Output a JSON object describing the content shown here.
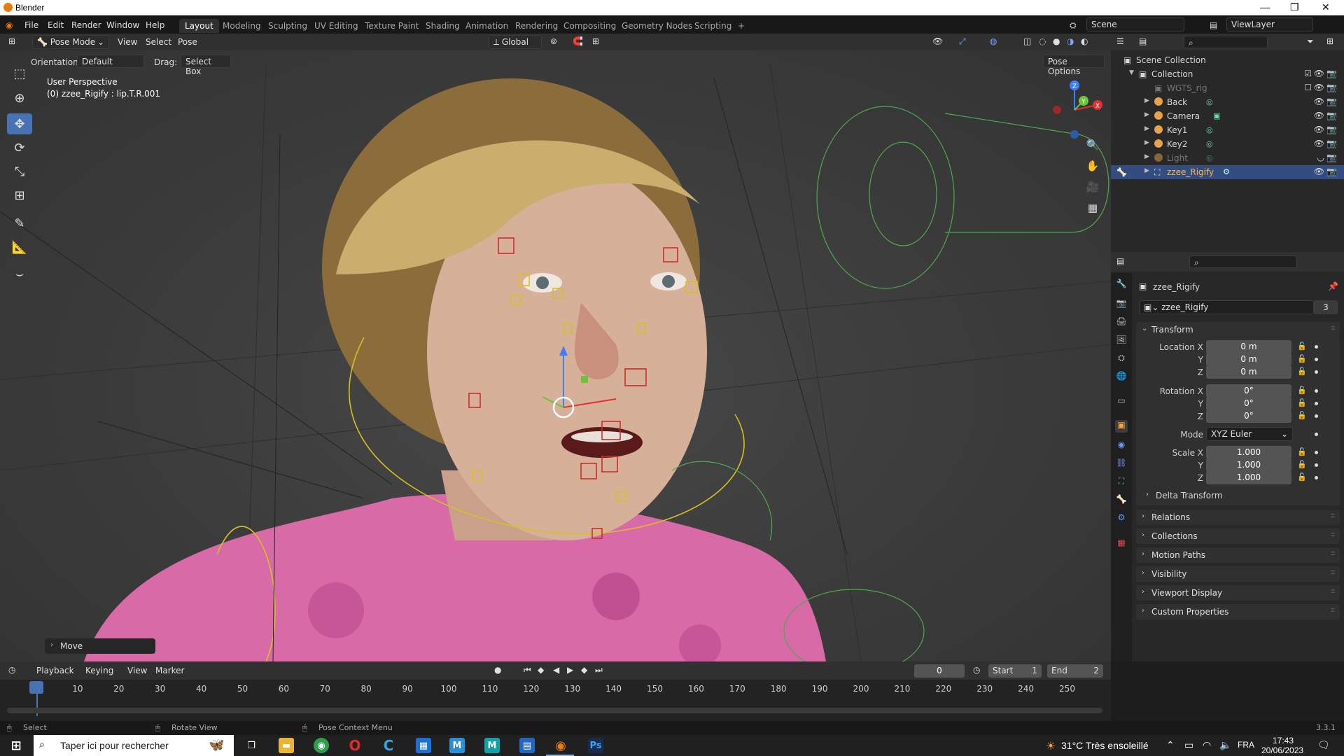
{
  "window": {
    "title": "Blender"
  },
  "menus": [
    "File",
    "Edit",
    "Render",
    "Window",
    "Help"
  ],
  "workspaces": [
    "Layout",
    "Modeling",
    "Sculpting",
    "UV Editing",
    "Texture Paint",
    "Shading",
    "Animation",
    "Rendering",
    "Compositing",
    "Geometry Nodes",
    "Scripting",
    "+"
  ],
  "active_workspace": "Layout",
  "scene": {
    "label": "Scene",
    "view_layer": "ViewLayer"
  },
  "viewport_header": {
    "mode": "Pose Mode",
    "menus": [
      "View",
      "Select",
      "Pose"
    ],
    "transform_orientation": "Global",
    "orientation_label": "Orientation:",
    "orientation_value": "Default",
    "drag_label": "Drag:",
    "drag_value": "Select Box",
    "pose_options": "Pose Options"
  },
  "viewport": {
    "perspective": "User Perspective",
    "active_info": "(0) zzee_Rigify : lip.T.R.001",
    "last_op": "Move",
    "gizmo_axes": [
      "Z",
      "Y",
      "X"
    ]
  },
  "outliner": {
    "root": "Scene Collection",
    "collection": "Collection",
    "items": [
      {
        "name": "WGTS_rig",
        "dim": true
      },
      {
        "name": "Back",
        "dim": false
      },
      {
        "name": "Camera",
        "dim": false
      },
      {
        "name": "Key1",
        "dim": false
      },
      {
        "name": "Key2",
        "dim": false
      },
      {
        "name": "Light",
        "dim": true
      },
      {
        "name": "zzee_Rigify",
        "dim": false,
        "selected": true
      }
    ]
  },
  "properties": {
    "object_name": "zzee_Rigify",
    "datablock_name": "zzee_Rigify",
    "users": "3",
    "transform_title": "Transform",
    "location_label": "Location X",
    "location": [
      "0 m",
      "0 m",
      "0 m"
    ],
    "rotation_label": "Rotation X",
    "rotation": [
      "0°",
      "0°",
      "0°"
    ],
    "mode_label": "Mode",
    "mode_value": "XYZ Euler",
    "scale_label": "Scale X",
    "scale": [
      "1.000",
      "1.000",
      "1.000"
    ],
    "axis_y": "Y",
    "axis_z": "Z",
    "delta_transform": "Delta Transform",
    "panels": [
      "Relations",
      "Collections",
      "Motion Paths",
      "Visibility",
      "Viewport Display",
      "Custom Properties"
    ]
  },
  "timeline": {
    "menus": [
      "Playback",
      "Keying",
      "View",
      "Marker"
    ],
    "current_frame": "0",
    "start_label": "Start",
    "start": "1",
    "end_label": "End",
    "end": "2",
    "ticks": [
      "0",
      "10",
      "20",
      "30",
      "40",
      "50",
      "60",
      "70",
      "80",
      "90",
      "100",
      "110",
      "120",
      "130",
      "140",
      "150",
      "160",
      "170",
      "180",
      "190",
      "200",
      "210",
      "220",
      "230",
      "240",
      "250"
    ]
  },
  "statusbar": {
    "select": "Select",
    "rotate": "Rotate View",
    "context": "Pose Context Menu",
    "version": "3.3.1"
  },
  "taskbar": {
    "search_placeholder": "Taper ici pour rechercher",
    "weather": "31°C  Très ensoleillé",
    "lang": "FRA",
    "time": "17:43",
    "date": "20/06/2023"
  }
}
